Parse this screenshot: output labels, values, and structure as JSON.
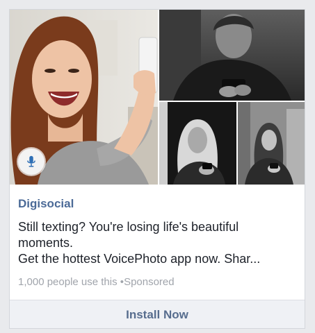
{
  "ad": {
    "sponsor_name": "Digisocial",
    "text_line1": "Still texting? You're losing life's beautiful",
    "text_line2": "moments.",
    "text_line3": "Get the hottest VoicePhoto app now. Shar...",
    "usage": "1,000 people use this",
    "separator": "•",
    "sponsored": "Sponsored",
    "cta_label": "Install Now"
  },
  "icons": {
    "mic": "microphone-icon"
  },
  "colors": {
    "page_bg": "#e9eaed",
    "sponsor_name": "#4b6a97",
    "cta_text": "#576d8e",
    "footer_bg": "#eff1f5",
    "meta_text": "#a0a4ab"
  }
}
